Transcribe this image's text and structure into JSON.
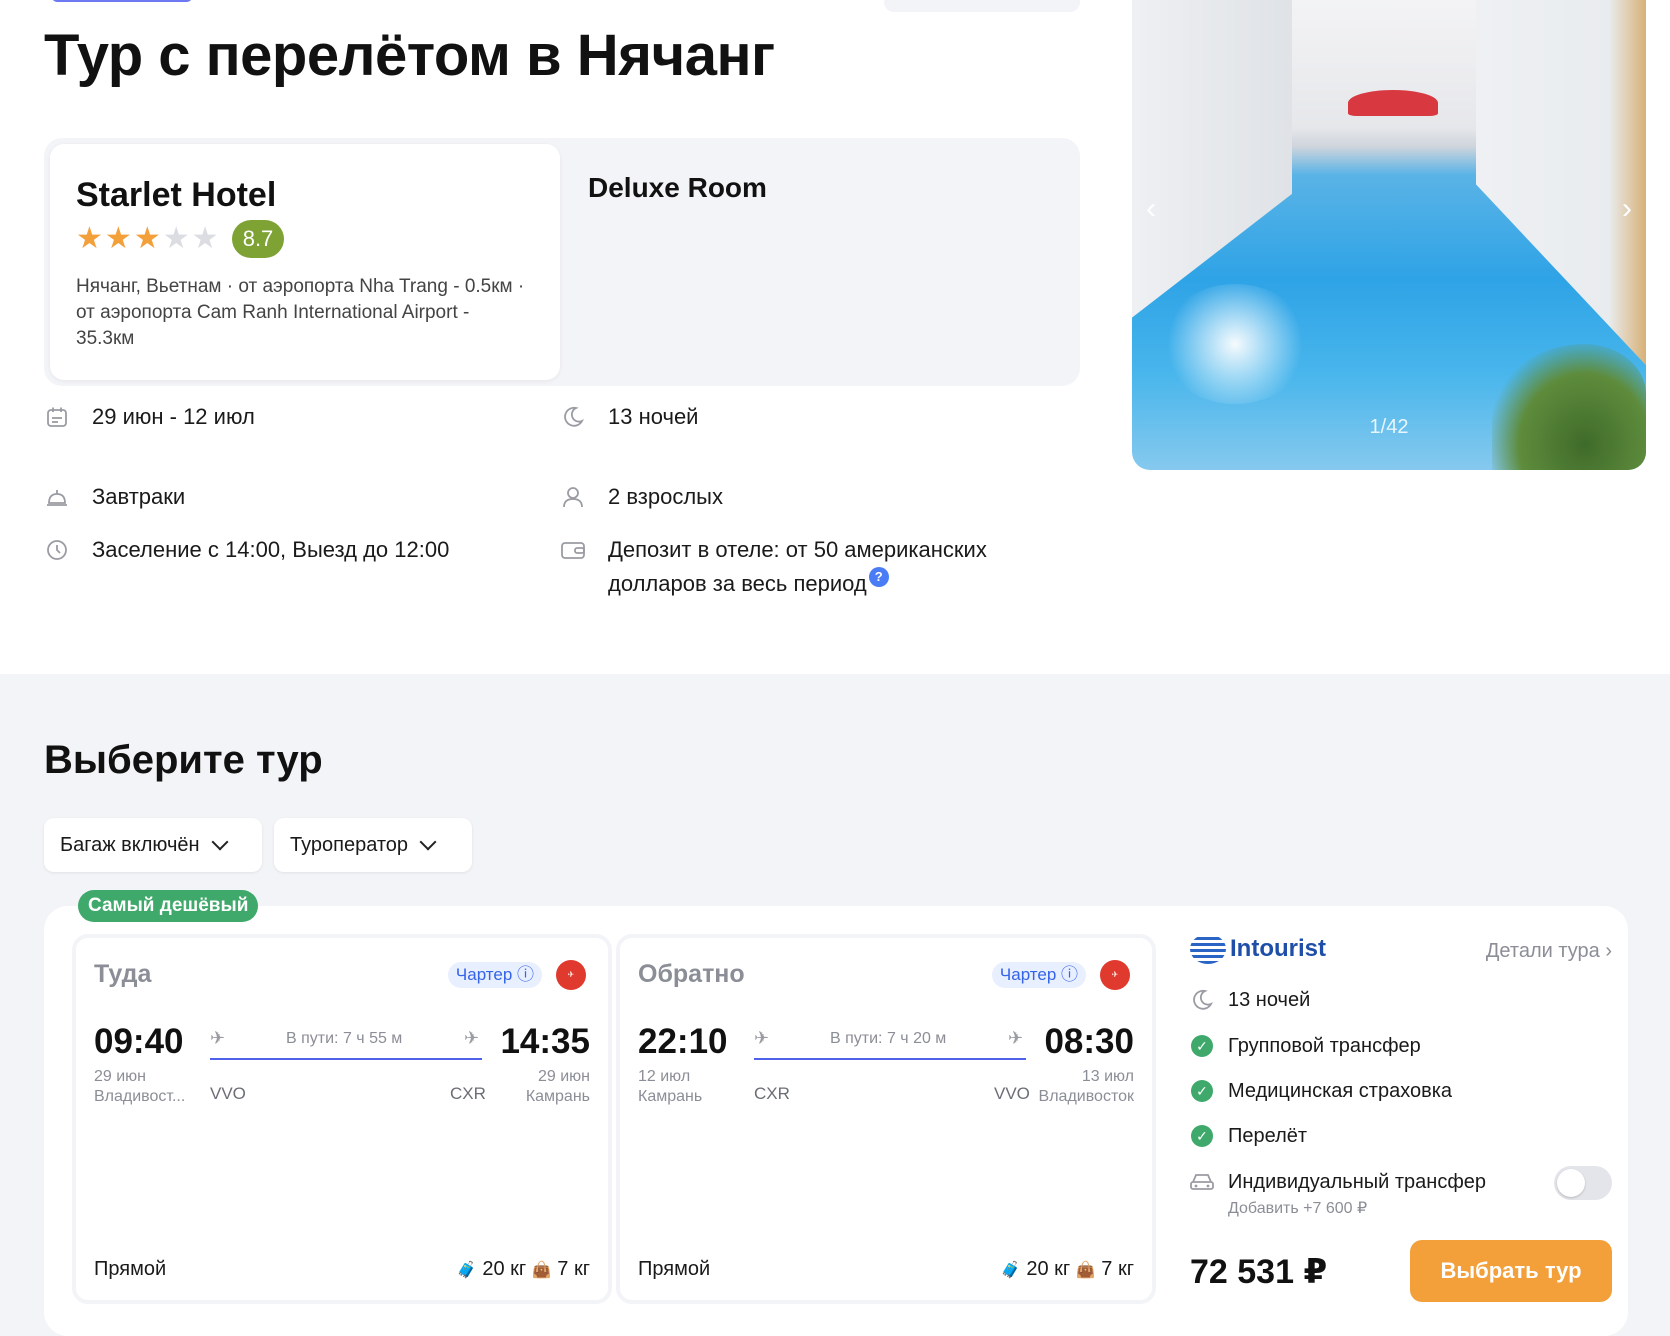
{
  "page_title": "Тур с перелётом в Нячанг",
  "hotel": {
    "name": "Starlet Hotel",
    "stars": 3,
    "stars_max": 5,
    "rating": "8.7",
    "location": "Нячанг, Вьетнам · от аэропорта Nha Trang - 0.5км · от аэропорта Cam Ranh International Airport - 35.3км",
    "room": "Deluxe Room"
  },
  "info": {
    "dates": "29 июн - 12 июл",
    "meals": "Завтраки",
    "checkin": "Заселение с 14:00, Выезд до 12:00",
    "nights": "13 ночей",
    "guests": "2 взрослых",
    "deposit": "Депозит в отеле: от 50 американских долларов за весь период"
  },
  "gallery": {
    "counter": "1/42"
  },
  "choose_section": {
    "title": "Выберите тур",
    "filters": [
      "Багаж включён",
      "Туроператор"
    ]
  },
  "tour": {
    "badge": "Самый дешёвый",
    "outbound": {
      "direction": "Туда",
      "charter": "Чартер ⓘ",
      "dep_time": "09:40",
      "dep_date": "29 июн",
      "dep_city": "Владивост...",
      "dep_code": "VVO",
      "duration": "В пути: 7 ч 55 м",
      "arr_code": "CXR",
      "arr_time": "14:35",
      "arr_date": "29 июн",
      "arr_city": "Камрань",
      "type": "Прямой",
      "baggage": "20 кг",
      "hand": "7 кг"
    },
    "inbound": {
      "direction": "Обратно",
      "charter": "Чартер ⓘ",
      "dep_time": "22:10",
      "dep_date": "12 июл",
      "dep_city": "Камрань",
      "dep_code": "CXR",
      "duration": "В пути: 7 ч 20 м",
      "arr_code": "VVO",
      "arr_time": "08:30",
      "arr_date": "13 июл",
      "arr_city": "Владивосток",
      "type": "Прямой",
      "baggage": "20 кг",
      "hand": "7 кг"
    },
    "operator": "Intourist",
    "details": "Детали тура",
    "nights": "13 ночей",
    "features": [
      "Групповой трансфер",
      "Медицинская страховка",
      "Перелёт"
    ],
    "individual_transfer": "Индивидуальный трансфер",
    "individual_add": "Добавить +7 600 ₽",
    "price": "72 531 ₽",
    "cta": "Выбрать тур"
  },
  "colors": {
    "accent": "#f3a03b",
    "rating": "#7ea234",
    "badge": "#3fa96b",
    "route": "#5061e9"
  }
}
